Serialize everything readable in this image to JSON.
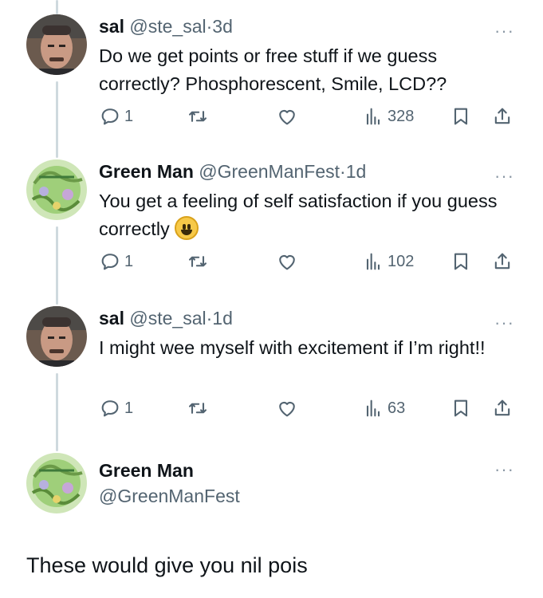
{
  "tweets": [
    {
      "name": "sal",
      "handle": "@ste_sal",
      "sep": "·",
      "time": "3d",
      "text": "Do we get points or free stuff if we guess correctly? Phosphorescent, Smile, LCD??",
      "replies": "1",
      "views": "328"
    },
    {
      "name": "Green Man",
      "handle": "@GreenManFest",
      "sep": "·",
      "time": "1d",
      "text": "You get a feeling of self satisfaction if you guess correctly",
      "emoji": "smiling-face-emoji",
      "replies": "1",
      "views": "102"
    },
    {
      "name": "sal",
      "handle": "@ste_sal",
      "sep": "·",
      "time": "1d",
      "text": "I might wee myself with excitement if I’m right!!",
      "replies": "1",
      "views": "63"
    }
  ],
  "main_tweet": {
    "name": "Green Man",
    "handle": "@GreenManFest",
    "text": "These would give you nil pois"
  },
  "icons": {
    "reply": "reply-icon",
    "retweet": "retweet-icon",
    "like": "heart-icon",
    "views": "views-chart-icon",
    "bookmark": "bookmark-icon",
    "share": "share-icon",
    "more": "more-icon"
  },
  "more_glyph": "···",
  "colors": {
    "text": "#0f1419",
    "secondary": "#536471",
    "thread_line": "#cfd9de",
    "avatar_green": "#8fbf6a"
  }
}
